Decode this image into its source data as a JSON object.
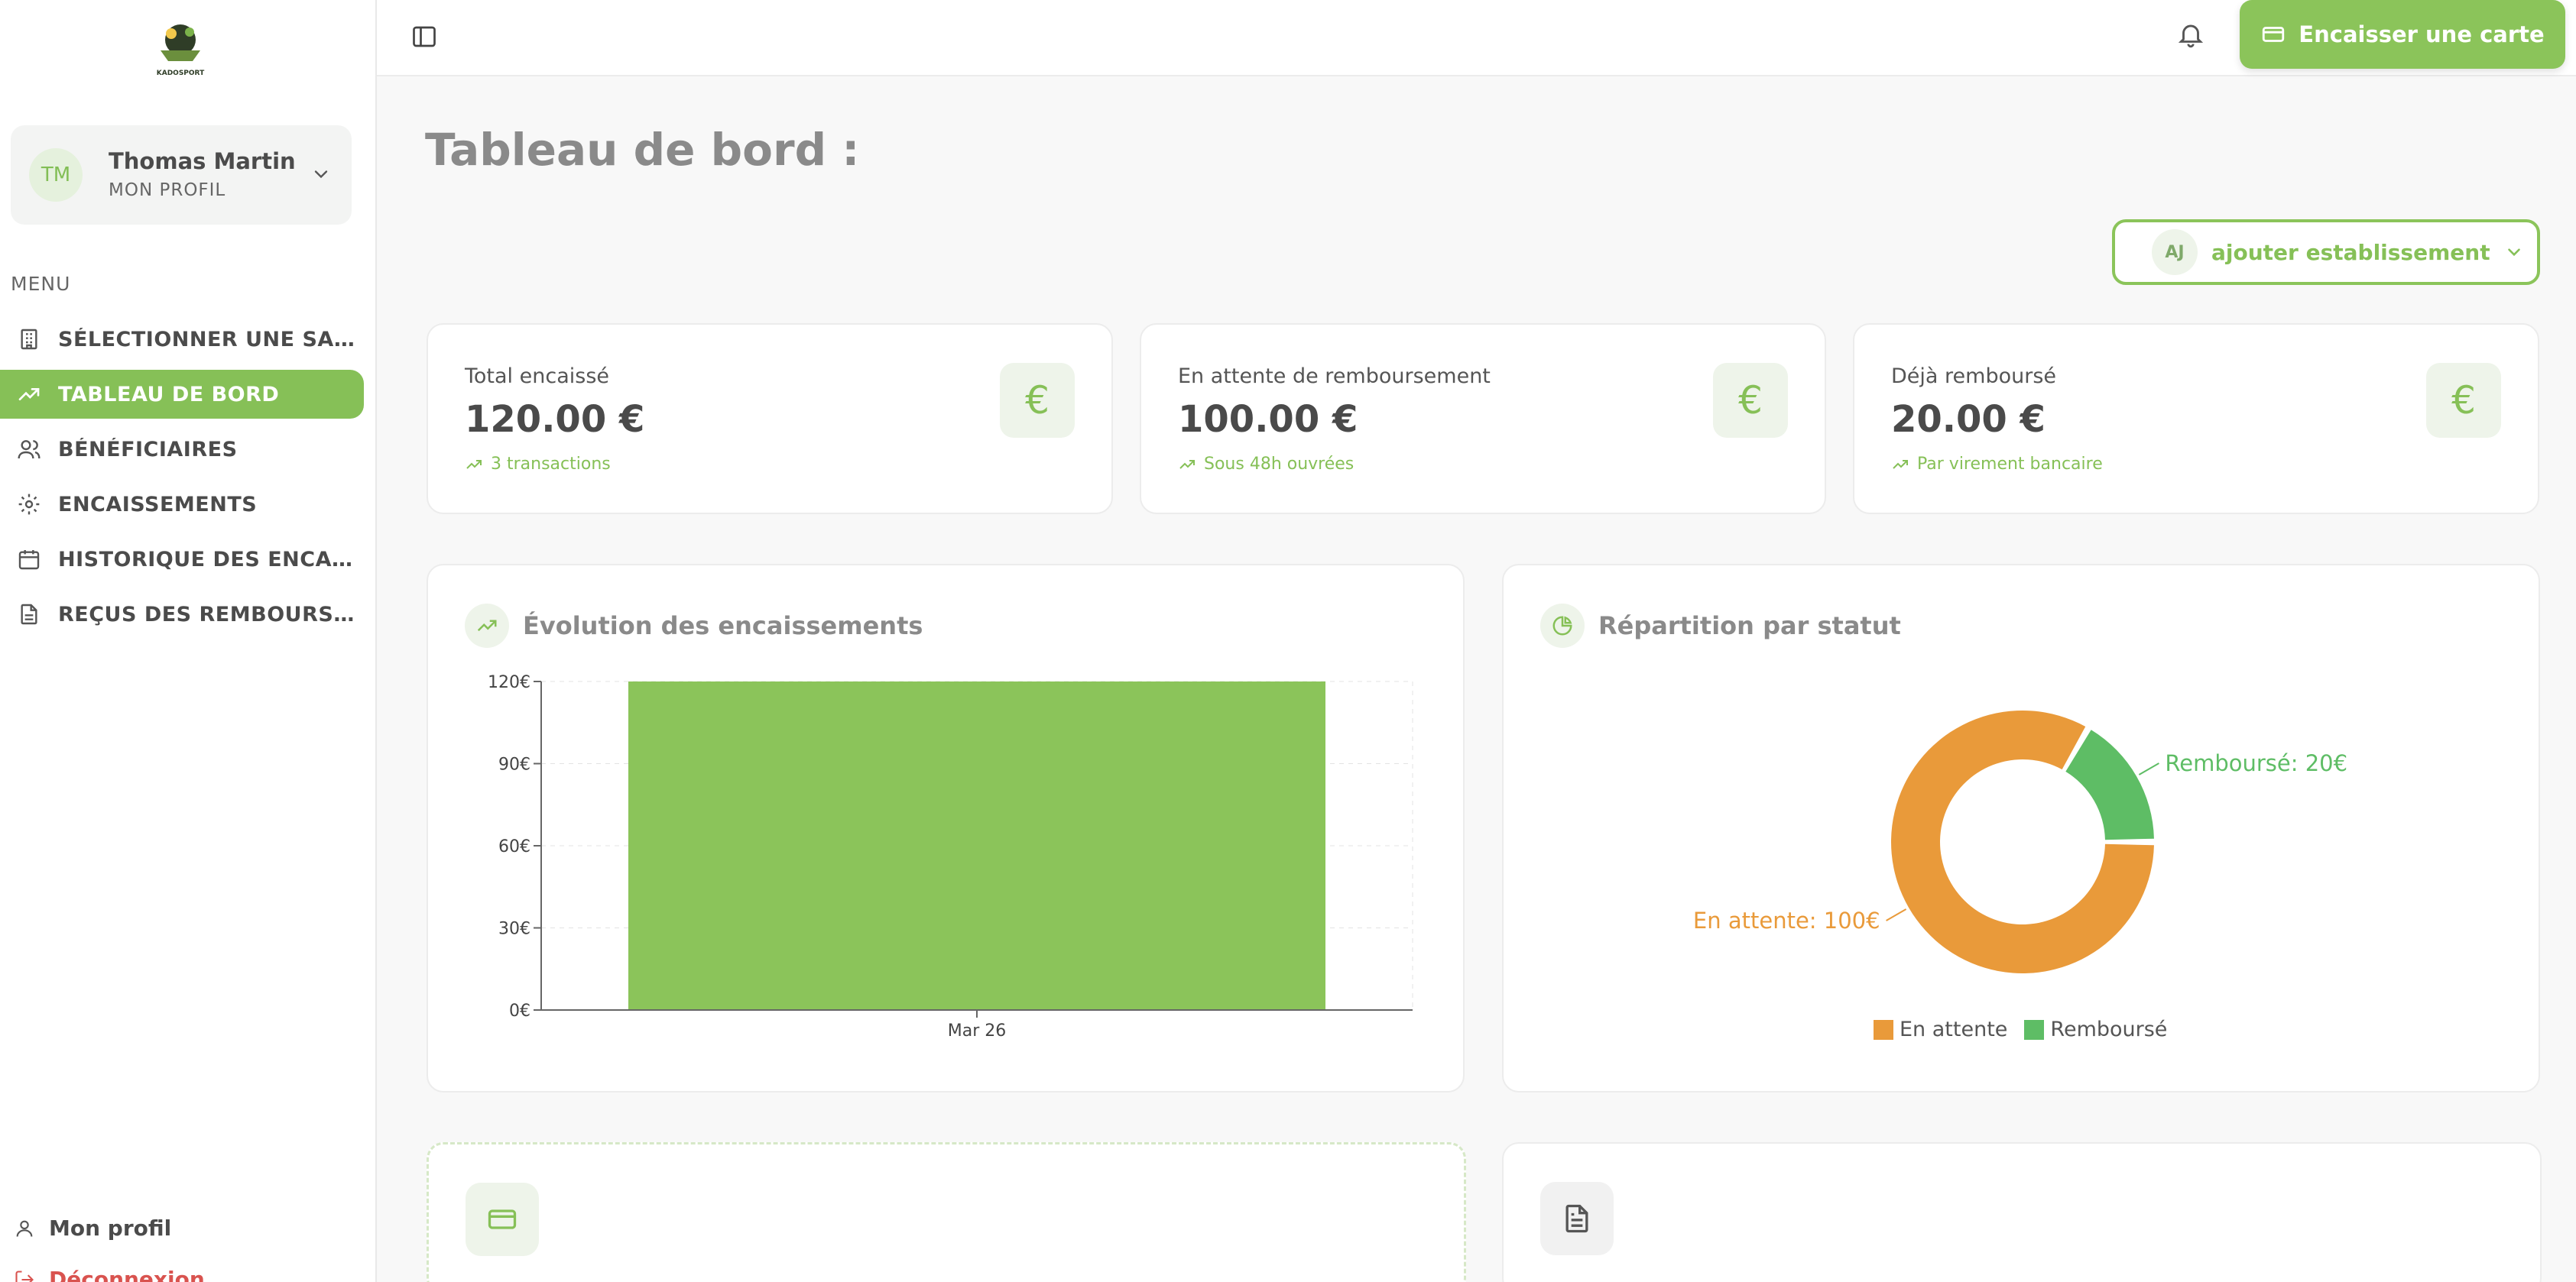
{
  "app": {
    "logo_text": "KADOSPORT"
  },
  "profile": {
    "initials": "TM",
    "name": "Thomas Martin",
    "subtitle": "MON PROFIL"
  },
  "sidebar": {
    "menu_title": "MENU",
    "items": [
      {
        "label": "SÉLECTIONNER UNE SALLE",
        "icon": "building-icon",
        "active": false
      },
      {
        "label": "TABLEAU DE BORD",
        "icon": "trending-up-icon",
        "active": true
      },
      {
        "label": "BÉNÉFICIAIRES",
        "icon": "users-icon",
        "active": false
      },
      {
        "label": "ENCAISSEMENTS",
        "icon": "gear-icon",
        "active": false
      },
      {
        "label": "HISTORIQUE DES ENCAISSEMENTS",
        "icon": "calendar-icon",
        "active": false
      },
      {
        "label": "REÇUS DES REMBOURSEMENTS",
        "icon": "file-text-icon",
        "active": false
      }
    ],
    "bottom": {
      "profile_label": "Mon profil",
      "logout_label": "Déconnexion"
    }
  },
  "topbar": {
    "cta_label": "Encaisser une carte"
  },
  "page": {
    "title": "Tableau de bord :",
    "establishment": {
      "initials": "AJ",
      "label": "ajouter establissement"
    }
  },
  "stats": [
    {
      "label": "Total encaissé",
      "value": "120.00 €",
      "foot": "3 transactions",
      "icon": "€"
    },
    {
      "label": "En attente de remboursement",
      "value": "100.00 €",
      "foot": "Sous 48h ouvrées",
      "icon": "€"
    },
    {
      "label": "Déjà remboursé",
      "value": "20.00 €",
      "foot": "Par virement bancaire",
      "icon": "€"
    }
  ],
  "panels": {
    "evolution_title": "Évolution des encaissements",
    "repartition_title": "Répartition par statut"
  },
  "colors": {
    "accent": "#86c057",
    "pending": "#e99a3a",
    "refunded": "#5ebd65"
  },
  "chart_data": [
    {
      "type": "bar",
      "title": "Évolution des encaissements",
      "categories": [
        "Mar 26"
      ],
      "values": [
        120
      ],
      "ylim": [
        0,
        120
      ],
      "yticks": [
        "0€",
        "30€",
        "60€",
        "90€",
        "120€"
      ],
      "grid": true
    },
    {
      "type": "pie",
      "title": "Répartition par statut",
      "donut": true,
      "slices": [
        {
          "name": "En attente",
          "value": 100,
          "label": "En attente: 100€",
          "color": "#e99a3a"
        },
        {
          "name": "Remboursé",
          "value": 20,
          "label": "Remboursé: 20€",
          "color": "#5ebd65"
        }
      ],
      "legend": "bottom"
    }
  ]
}
